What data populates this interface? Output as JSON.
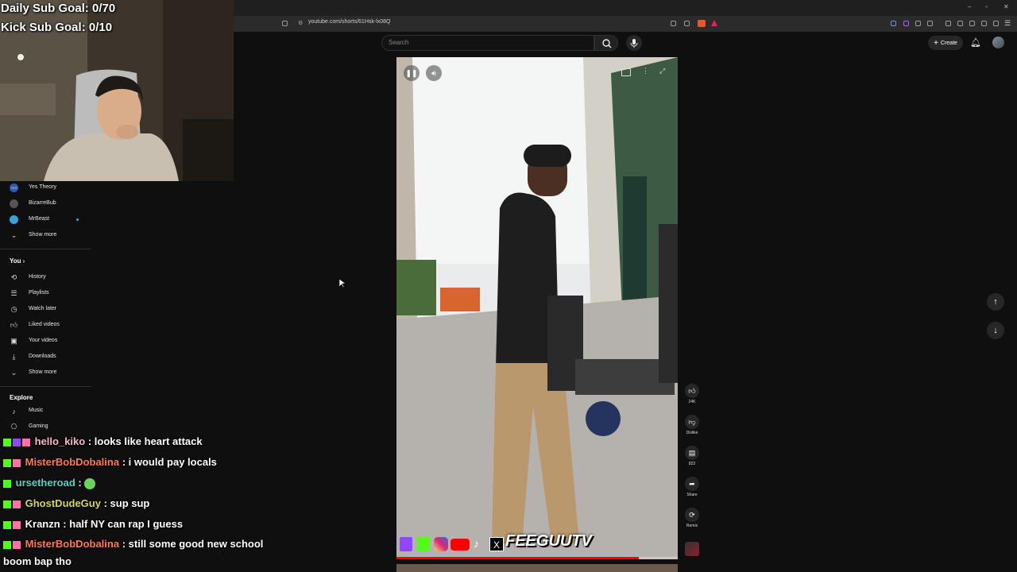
{
  "stream_overlay": {
    "daily_sub_goal": "Daily Sub Goal: 0/70",
    "kick_sub_goal": "Kick Sub Goal: 0/10"
  },
  "browser": {
    "url": "youtube.com/shorts/61Hsk-lx08Q",
    "window_controls": [
      "–",
      "▫",
      "✕"
    ]
  },
  "header": {
    "search_placeholder": "Search",
    "create_label": "Create"
  },
  "sidebar": {
    "subscriptions": [
      {
        "label": "Yes Theory",
        "icon": "channel-avatar"
      },
      {
        "label": "BizarreBub",
        "icon": "channel-avatar"
      },
      {
        "label": "MrBeast",
        "icon": "channel-avatar"
      }
    ],
    "subs_show_more": "Show more",
    "you_heading": "You",
    "you_items": [
      {
        "label": "History",
        "icon": "history-icon"
      },
      {
        "label": "Playlists",
        "icon": "playlists-icon"
      },
      {
        "label": "Watch later",
        "icon": "watch-later-icon"
      },
      {
        "label": "Liked videos",
        "icon": "thumbs-up-icon"
      },
      {
        "label": "Your videos",
        "icon": "your-videos-icon"
      },
      {
        "label": "Downloads",
        "icon": "download-icon"
      }
    ],
    "you_show_more": "Show more",
    "explore_heading": "Explore",
    "explore_items": [
      {
        "label": "Music",
        "icon": "music-icon"
      },
      {
        "label": "Gaming",
        "icon": "gaming-icon"
      }
    ]
  },
  "chat": [
    {
      "user": "hello_kiko",
      "user_color": "#ffb6c8",
      "message": "looks like heart attack"
    },
    {
      "user": "MisterBobDobalina",
      "user_color": "#ff7a4d",
      "message": "i would pay locals"
    },
    {
      "user": "ursetheroad",
      "user_color": "#5ad2c8",
      "message": ""
    },
    {
      "user": "GhostDudeGuy",
      "user_color": "#d8d84a",
      "message": "sup sup"
    },
    {
      "user": "Kranzn",
      "user_color": "#ffffff",
      "message": "half NY can rap I guess"
    },
    {
      "user": "MisterBobDobalina",
      "user_color": "#ff7a4d",
      "message": "still some good new school"
    },
    {
      "user": "",
      "user_color": "#ffffff",
      "message": "boom bap tho"
    }
  ],
  "video": {
    "watermark": "FEEGUUTV",
    "social_icons": [
      "twitch-icon",
      "kick-icon",
      "instagram-icon",
      "youtube-icon",
      "tiktok-icon",
      "x-icon"
    ]
  },
  "actions": {
    "like_count": "24K",
    "dislike_label": "Dislike",
    "comment_count": "822",
    "share_label": "Share",
    "remix_label": "Remix"
  },
  "colors": {
    "background": "#0f0f0f",
    "accent": "#ff0000"
  }
}
